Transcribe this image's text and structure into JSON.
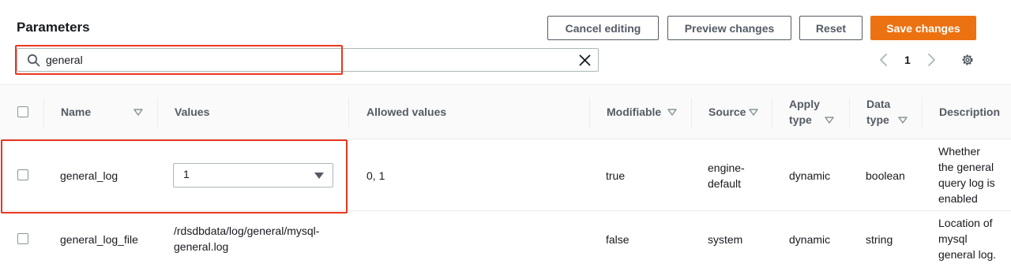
{
  "header": {
    "title": "Parameters",
    "buttons": {
      "cancel": "Cancel editing",
      "preview": "Preview changes",
      "reset": "Reset",
      "save": "Save changes"
    }
  },
  "search": {
    "value": "general",
    "icon": "search-icon",
    "clear_icon": "close-icon"
  },
  "pagination": {
    "current_page": "1"
  },
  "table": {
    "columns": {
      "name": "Name",
      "values": "Values",
      "allowed_values": "Allowed values",
      "modifiable": "Modifiable",
      "source": "Source",
      "apply_type_line1": "Apply",
      "apply_type_line2": "type",
      "data_type_line1": "Data",
      "data_type_line2": "type",
      "description": "Description"
    },
    "rows": [
      {
        "name": "general_log",
        "value": "1",
        "allowed_values": "0, 1",
        "modifiable": "true",
        "source_line1": "engine-",
        "source_line2": "default",
        "apply_type": "dynamic",
        "data_type": "boolean",
        "description": [
          "Whether",
          "the general",
          "query log is",
          "enabled"
        ]
      },
      {
        "name": "general_log_file",
        "value_line1": "/rdsdbdata/log/general/mysql-",
        "value_line2": "general.log",
        "allowed_values": "",
        "modifiable": "false",
        "source": "system",
        "apply_type": "dynamic",
        "data_type": "string",
        "description": [
          "Location of",
          "mysql",
          "general log."
        ]
      }
    ]
  },
  "colors": {
    "primary_button": "#ec7211",
    "highlight_annotation": "#e9371f",
    "text": "#16191f",
    "secondary_text": "#545b64"
  }
}
